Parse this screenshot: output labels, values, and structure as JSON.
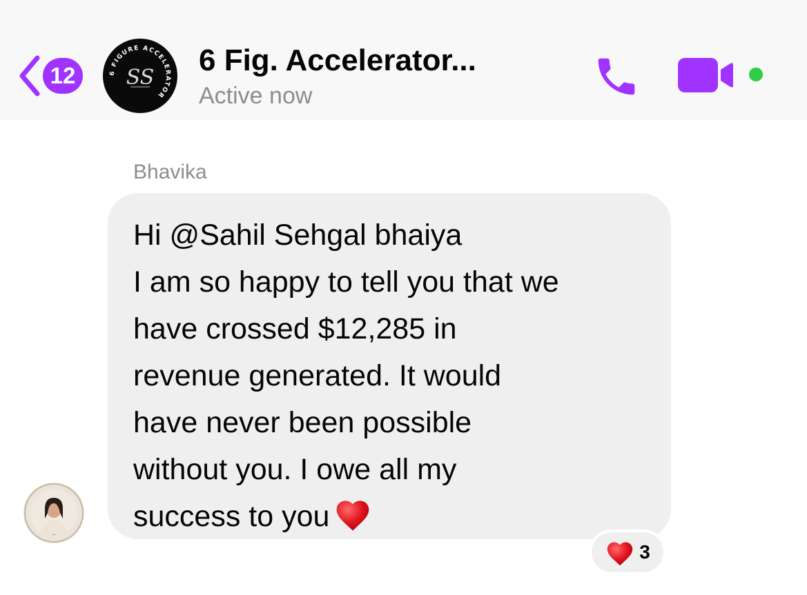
{
  "header": {
    "unread_count": "12",
    "title": "6 Fig. Accelerator...",
    "status": "Active now",
    "avatar_text": "6 FIGURE ACCELERATOR",
    "avatar_monogram": "SS",
    "icons": {
      "back": "chevron-left-icon",
      "call": "phone-icon",
      "video": "video-camera-icon",
      "online": "online-dot"
    },
    "accent_color": "#a033ff",
    "online_color": "#31cc46"
  },
  "message": {
    "sender": "Bhavika",
    "lines": [
      "Hi @Sahil Sehgal bhaiya",
      "I am so happy to tell you that we",
      "have crossed $12,285 in",
      "revenue generated. It would",
      "have never been possible",
      "without you. I owe all my",
      "success to you"
    ],
    "trailing_emoji": "red-heart-icon",
    "bubble_color": "#efefef",
    "reaction": {
      "emoji": "red-heart-icon",
      "count": "3"
    }
  }
}
